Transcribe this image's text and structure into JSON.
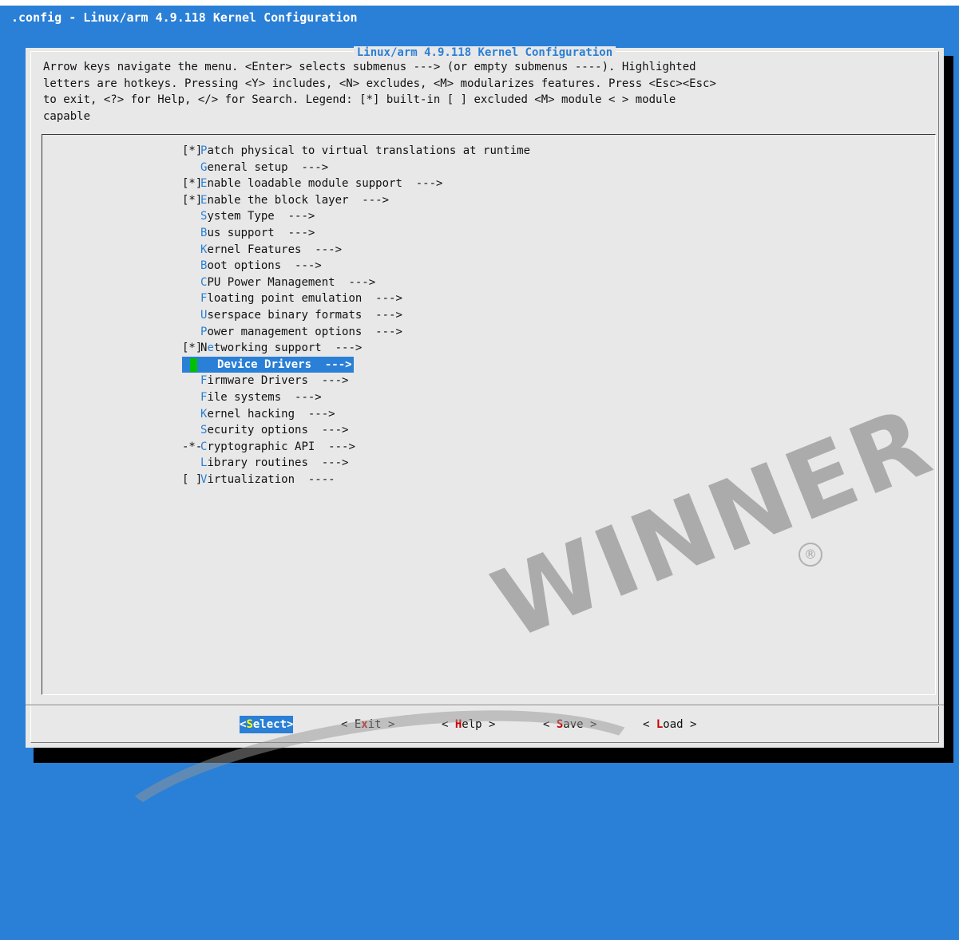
{
  "window": {
    "title": ".config - Linux/arm 4.9.118 Kernel Configuration"
  },
  "dialog": {
    "title": "Linux/arm 4.9.118 Kernel Configuration",
    "help_lines": [
      "Arrow keys navigate the menu.  <Enter> selects submenus ---> (or empty submenus ----).  Highlighted",
      "letters are hotkeys.  Pressing <Y> includes, <N> excludes, <M> modularizes features.  Press <Esc><Esc>",
      "to exit, <?> for Help, </> for Search.  Legend: [*] built-in  [ ] excluded  <M> module  < > module",
      "capable"
    ]
  },
  "menu": {
    "items": [
      {
        "mark": "[*]",
        "hotkey": "P",
        "rest": "atch physical to virtual translations at runtime"
      },
      {
        "mark": "",
        "hotkey": "G",
        "rest": "eneral setup  --->"
      },
      {
        "mark": "[*]",
        "hotkey": "E",
        "rest": "nable loadable module support  --->"
      },
      {
        "mark": "[*]",
        "hotkey": "E",
        "rest": "nable the block layer  --->"
      },
      {
        "mark": "",
        "hotkey": "S",
        "rest": "ystem Type  --->"
      },
      {
        "mark": "",
        "hotkey": "B",
        "rest": "us support  --->"
      },
      {
        "mark": "",
        "hotkey": "K",
        "rest": "ernel Features  --->"
      },
      {
        "mark": "",
        "hotkey": "B",
        "rest": "oot options  --->"
      },
      {
        "mark": "",
        "hotkey": "C",
        "rest": "PU Power Management  --->"
      },
      {
        "mark": "",
        "hotkey": "F",
        "rest": "loating point emulation  --->"
      },
      {
        "mark": "",
        "hotkey": "U",
        "rest": "serspace binary formats  --->"
      },
      {
        "mark": "",
        "hotkey": "P",
        "rest": "ower management options  --->"
      },
      {
        "mark": "[*]",
        "pre": "N",
        "hotkey": "e",
        "rest": "tworking support  --->"
      },
      {
        "mark": "",
        "hotkey": "D",
        "rest": "evice Drivers  --->",
        "selected": true
      },
      {
        "mark": "",
        "hotkey": "F",
        "rest": "irmware Drivers  --->"
      },
      {
        "mark": "",
        "hotkey": "F",
        "rest": "ile systems  --->"
      },
      {
        "mark": "",
        "hotkey": "K",
        "rest": "ernel hacking  --->"
      },
      {
        "mark": "",
        "hotkey": "S",
        "rest": "ecurity options  --->"
      },
      {
        "mark": "-*-",
        "hotkey": "C",
        "rest": "ryptographic API  --->"
      },
      {
        "mark": "",
        "hotkey": "L",
        "rest": "ibrary routines  --->"
      },
      {
        "mark": "[ ]",
        "hotkey": "V",
        "rest": "irtualization  ----"
      }
    ]
  },
  "buttons": [
    {
      "pre": "<",
      "hot": "S",
      "post": "elect>",
      "active": true
    },
    {
      "pre": "< E",
      "hot": "x",
      "post": "it >"
    },
    {
      "pre": "< ",
      "hot": "H",
      "post": "elp >"
    },
    {
      "pre": "< ",
      "hot": "S",
      "post": "ave >"
    },
    {
      "pre": "< ",
      "hot": "L",
      "post": "oad >"
    }
  ],
  "watermark": {
    "text": "WINNER",
    "reg": "®"
  },
  "colors": {
    "accent": "#2a7fd6",
    "dialog_bg": "#e8e8e8",
    "hotkey_red": "#cc0000",
    "cursor_green": "#00c000"
  }
}
